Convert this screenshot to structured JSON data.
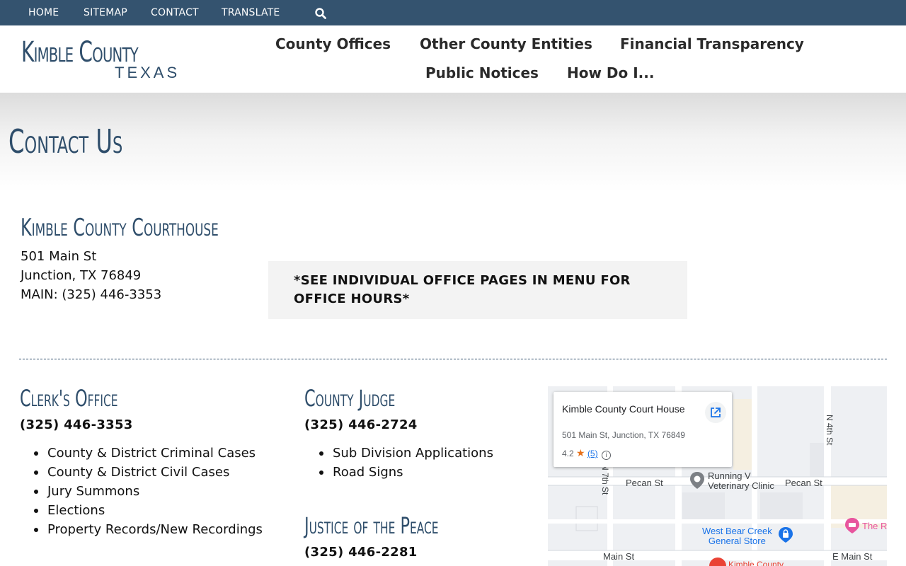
{
  "topbar": {
    "home": "HOME",
    "sitemap": "SITEMAP",
    "contact": "CONTACT",
    "translate": "TRANSLATE",
    "search_icon": "search-icon"
  },
  "logo": {
    "main": "Kimble County",
    "sub": "TEXAS"
  },
  "nav": {
    "county_offices": "County Offices",
    "other_entities": "Other County Entities",
    "financial": "Financial Transparency",
    "public_notices": "Public Notices",
    "how_do_i": "How Do I..."
  },
  "page": {
    "title": "Contact Us"
  },
  "courthouse": {
    "title": "Kimble County Courthouse",
    "street": "501 Main St",
    "city": "Junction, TX 76849",
    "main_phone": "MAIN: (325) 446-3353"
  },
  "notice": {
    "text": "*SEE INDIVIDUAL OFFICE PAGES IN MENU FOR OFFICE HOURS*"
  },
  "clerk": {
    "title": "Clerk's Office",
    "phone": "(325) 446-3353",
    "items": [
      "County & District Criminal Cases",
      "County & District Civil Cases",
      "Jury Summons",
      "Elections",
      "Property Records/New Recordings"
    ]
  },
  "judge": {
    "title": "County Judge",
    "phone": "(325) 446-2724",
    "items": [
      "Sub Division Applications",
      "Road Signs"
    ]
  },
  "justice": {
    "title": "Justice of the Peace",
    "phone": "(325) 446-2281"
  },
  "map": {
    "place_name": "Kimble County Court House",
    "place_address": "501 Main St, Junction, TX 76849",
    "rating": "4.2",
    "review_count": "(5)",
    "streets": {
      "pecan_left": "Pecan St",
      "pecan_right": "Pecan St",
      "main_left": "Main St",
      "main_right": "E Main St",
      "n7th": "N 7th St",
      "n4th": "N 4th St"
    },
    "pois": {
      "clinic_line1": "Running V",
      "clinic_line2": "Veterinary Clinic",
      "store_line1": "West Bear Creek",
      "store_line2": "General Store",
      "right_cut": "The R",
      "bottom_cut": "Kimble County"
    },
    "colors": {
      "road": "#ffffff",
      "block": "#eef0f3",
      "pin_red": "#ea4335",
      "poi_blue": "#1a73e8",
      "poi_pink": "#e8559e"
    }
  },
  "colors": {
    "topbar": "#34536f",
    "heading": "#2f4e6b"
  }
}
